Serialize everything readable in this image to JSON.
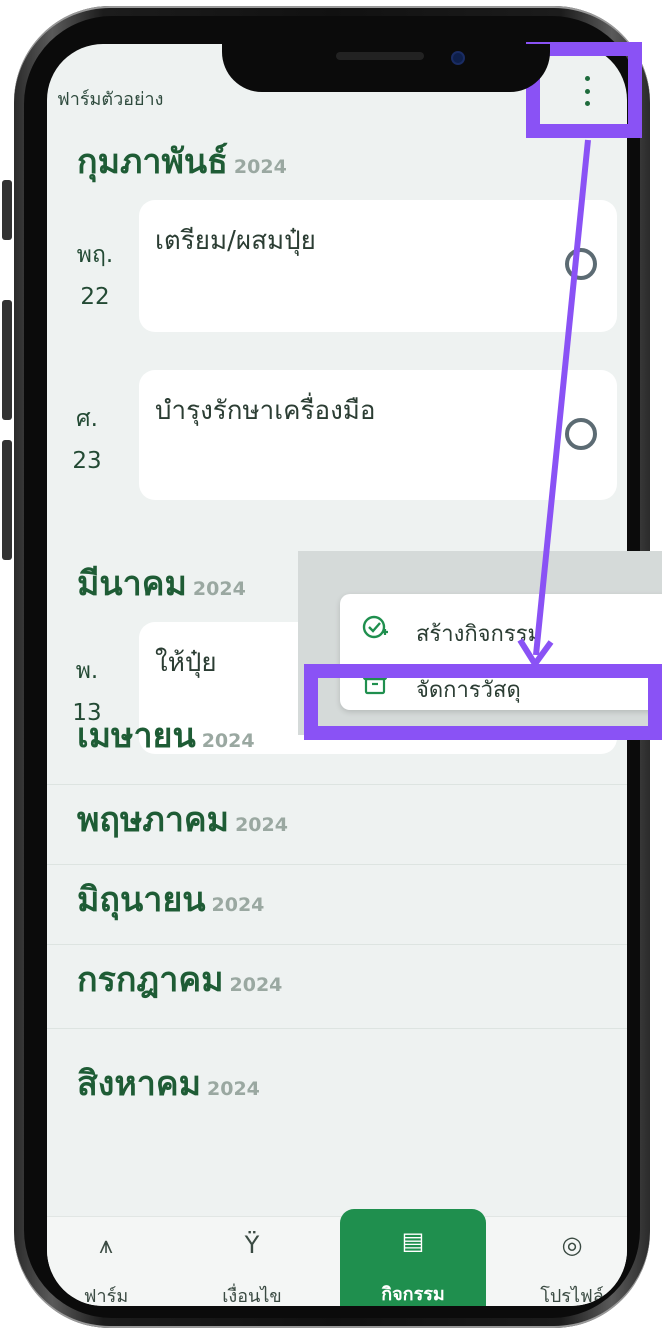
{
  "app": {
    "farm_name": "ฟาร์มตัวอย่าง"
  },
  "months": [
    {
      "name": "กุมภาพันธ์",
      "year": "2024"
    },
    {
      "name": "มีนาคม",
      "year": "2024"
    },
    {
      "name": "เมษายน",
      "year": "2024"
    },
    {
      "name": "พฤษภาคม",
      "year": "2024"
    },
    {
      "name": "มิถุนายน",
      "year": "2024"
    },
    {
      "name": "กรกฎาคม",
      "year": "2024"
    },
    {
      "name": "สิงหาคม",
      "year": "2024"
    }
  ],
  "activities": [
    {
      "weekday": "พฤ.",
      "day": "22",
      "title": "เตรียม/ผสมปุ๋ย"
    },
    {
      "weekday": "ศ.",
      "day": "23",
      "title": "บำรุงรักษาเครื่องมือ"
    },
    {
      "weekday": "พ.",
      "day": "13",
      "title": "ให้ปุ๋ย"
    }
  ],
  "popup_menu": {
    "items": [
      {
        "label": "สร้างกิจกรรม",
        "icon": "check-plus-icon"
      },
      {
        "label": "จัดการวัสดุ",
        "icon": "archive-icon"
      }
    ]
  },
  "bottom_nav": {
    "items": [
      {
        "label": "ฟาร์ม",
        "icon": "farm-icon",
        "active": false
      },
      {
        "label": "เงื่อนไข",
        "icon": "branch-icon",
        "active": false
      },
      {
        "label": "กิจกรรม",
        "icon": "calendar-icon",
        "active": true
      },
      {
        "label": "โปรไฟล์",
        "icon": "profile-icon",
        "active": false
      }
    ]
  },
  "colors": {
    "accent": "#1f8f4e",
    "month_heading": "#1e5c35",
    "annotation": "#8a52f5",
    "screen_bg": "#eef2f1"
  }
}
